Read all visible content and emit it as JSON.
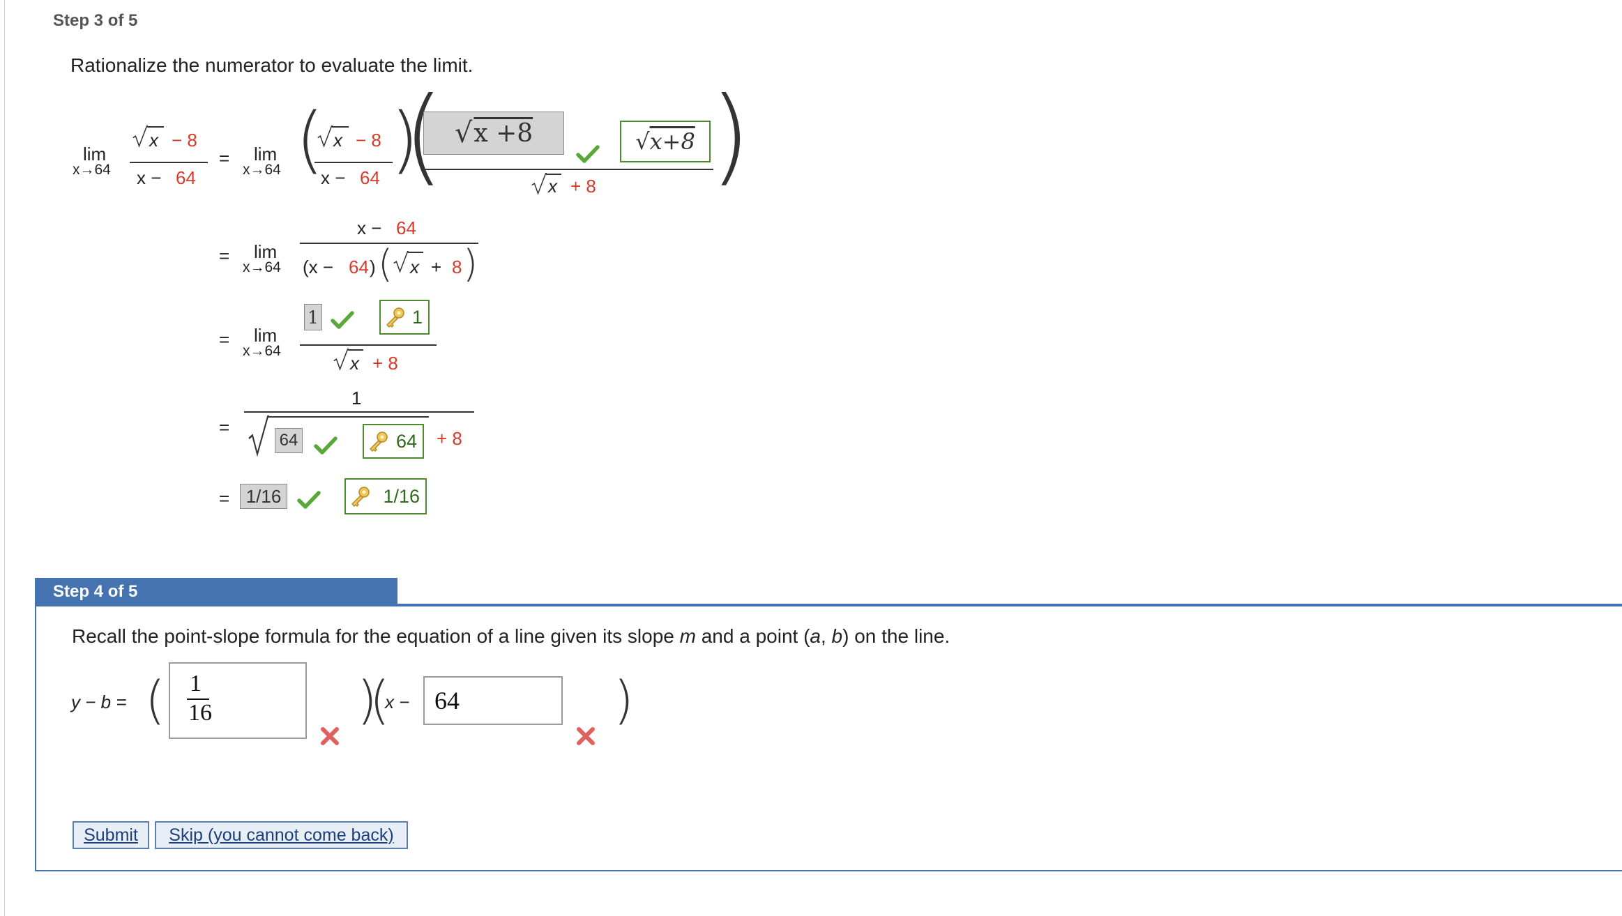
{
  "step3": {
    "title": "Step 3 of 5",
    "instruction": "Rationalize the numerator to evaluate the limit.",
    "lim": "lim",
    "sub": "x→64",
    "eq": "=",
    "row1": {
      "num_a": "x",
      "minus8": "− 8",
      "den_a": "x −",
      "den_b": "64",
      "conj_box": "x +8",
      "conj_answer": "x+8",
      "conj_den_x": "x",
      "conj_den_plus": "+ 8"
    },
    "row2": {
      "num_a": "x −",
      "num_b": "64",
      "den_a": "(x −",
      "den_b": "64",
      "den_c": ")",
      "den_x": "x",
      "den_plus": "+ 8"
    },
    "row3": {
      "box": "1",
      "answer": "1",
      "den_x": "x",
      "den_plus": "+ 8"
    },
    "row4": {
      "num": "1",
      "box": "64",
      "answer": "64",
      "plus8": "+ 8"
    },
    "row5": {
      "box": "1/16",
      "answer": "1/16"
    }
  },
  "step4": {
    "title": "Step 4 of 5",
    "instruction_prefix": "Recall the point-slope formula for the equation of a line given its slope ",
    "m": "m",
    "instruction_mid": " and a point (",
    "a": "a",
    "comma": ", ",
    "b": "b",
    "instruction_suffix": ") on the line.",
    "lhs": "y − b =",
    "slope_num": "1",
    "slope_den": "16",
    "x_minus": "x −",
    "point_value": "64"
  },
  "buttons": {
    "submit": "Submit",
    "skip": "Skip (you cannot come back)"
  },
  "colors": {
    "accent": "#4573b0",
    "red_number": "#d83a2a",
    "correct_green": "#5aa83a",
    "wrong_red": "#e06060"
  }
}
